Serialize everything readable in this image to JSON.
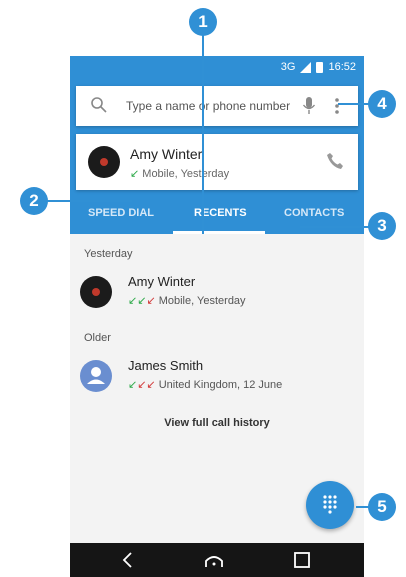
{
  "status_bar": {
    "network": "3G",
    "time": "16:52"
  },
  "search": {
    "placeholder": "Type a name or phone number"
  },
  "top_contact": {
    "name": "Amy Winter",
    "detail": "Mobile, Yesterday"
  },
  "tabs": [
    {
      "label": "SPEED DIAL",
      "active": false
    },
    {
      "label": "RECENTS",
      "active": true
    },
    {
      "label": "CONTACTS",
      "active": false
    }
  ],
  "recents": {
    "sections": [
      {
        "label": "Yesterday",
        "items": [
          {
            "name": "Amy Winter",
            "detail": "Mobile, Yesterday",
            "avatar": "record-avatar"
          }
        ]
      },
      {
        "label": "Older",
        "items": [
          {
            "name": "James Smith",
            "detail": "United Kingdom, 12 June",
            "avatar": "person-avatar"
          }
        ]
      }
    ],
    "history_link": "View full call history"
  },
  "callouts": [
    "1",
    "2",
    "3",
    "4",
    "5"
  ],
  "icons": {
    "search": "search-icon",
    "mic": "mic-icon",
    "more": "more-vert-icon",
    "phone": "phone-icon",
    "dialpad": "dialpad-icon",
    "back": "back-icon",
    "home": "home-icon",
    "recents": "recent-apps-icon"
  },
  "colors": {
    "accent": "#2f8fd5",
    "callout": "#3090d5",
    "missed": "#d23a3a",
    "incoming": "#2eaa4a"
  }
}
